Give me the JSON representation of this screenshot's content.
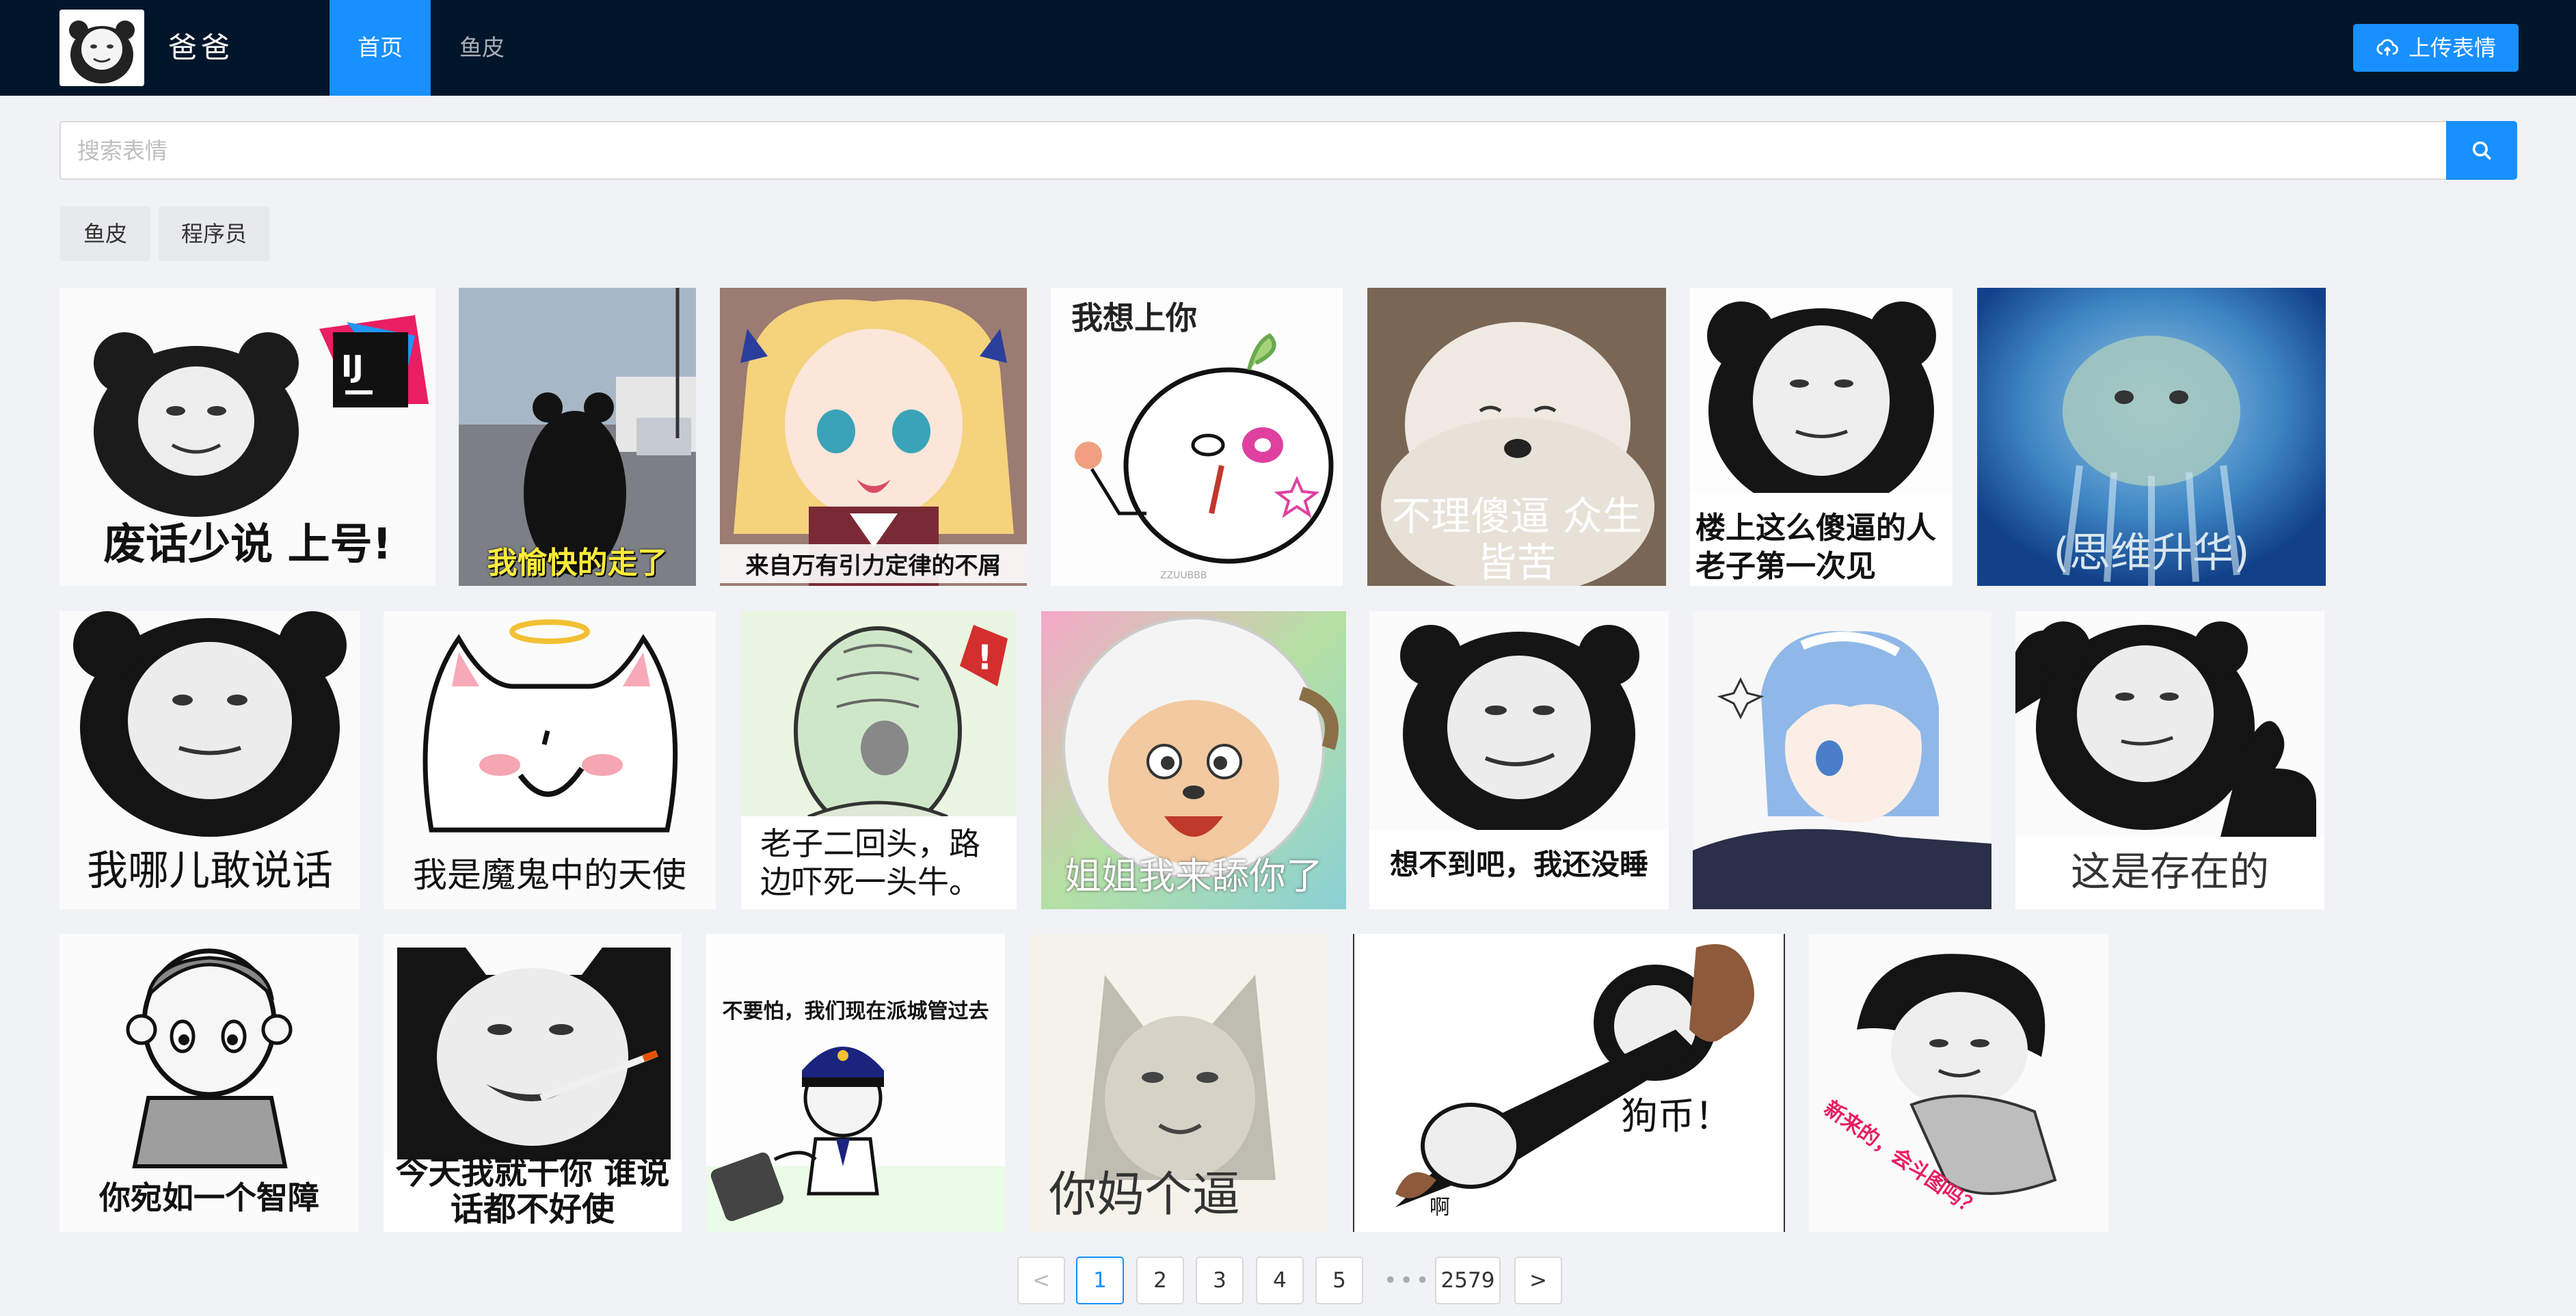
{
  "header": {
    "site_name": "爸爸",
    "nav": [
      {
        "label": "首页",
        "active": true
      },
      {
        "label": "鱼皮",
        "active": false
      }
    ],
    "upload_label": "上传表情"
  },
  "search": {
    "placeholder": "搜索表情",
    "value": ""
  },
  "tags": [
    "鱼皮",
    "程序员"
  ],
  "memes": [
    {
      "caption": "废话少说 上号!",
      "icon": "panda-face-icon",
      "badge": "IJ"
    },
    {
      "caption": "我愉快的走了",
      "icon": "bear-walking-icon"
    },
    {
      "caption": "来自万有引力定律的不屑",
      "icon": "anime-girl-icon"
    },
    {
      "caption": "我想上你",
      "icon": "doodle-face-icon",
      "watermark": "ZZUUBBB"
    },
    {
      "caption": "不理傻逼 众生皆苦",
      "icon": "dog-icon"
    },
    {
      "caption": "楼上这么傻逼的人 老子第一次见",
      "icon": "panda-face-icon"
    },
    {
      "caption": "(思维升华)",
      "icon": "seal-icon"
    },
    {
      "caption": "我哪儿敢说话",
      "icon": "panda-face-icon"
    },
    {
      "caption": "我是魔鬼中的天使",
      "icon": "cat-angel-icon"
    },
    {
      "caption": "老子二回头，路边吓死一头牛。",
      "icon": "face-turn-icon"
    },
    {
      "caption": "姐姐我来舔你了",
      "icon": "sheep-icon"
    },
    {
      "caption": "想不到吧，我还没睡",
      "icon": "panda-face-icon"
    },
    {
      "caption": "",
      "icon": "anime-maid-icon"
    },
    {
      "caption": "这是存在的",
      "icon": "panda-thumb-icon"
    },
    {
      "caption": "你宛如一个智障",
      "icon": "cartoon-boy-icon"
    },
    {
      "caption": "今天我就干你 谁说话都不好使",
      "icon": "panda-smoke-icon"
    },
    {
      "caption": "不要怕，我们现在派城管过去",
      "icon": "police-icon"
    },
    {
      "caption": "你妈个逼",
      "icon": "wolf-face-icon"
    },
    {
      "caption": "狗币！",
      "icon": "panda-gourd-icon",
      "side": "啊"
    },
    {
      "caption": "新来的，会斗图吗？",
      "icon": "mushroom-head-icon"
    }
  ],
  "pagination": {
    "pages": [
      "1",
      "2",
      "3",
      "4",
      "5"
    ],
    "current": "1",
    "ellipsis": "•••",
    "last": "2579",
    "prev": "<",
    "next": ">"
  }
}
